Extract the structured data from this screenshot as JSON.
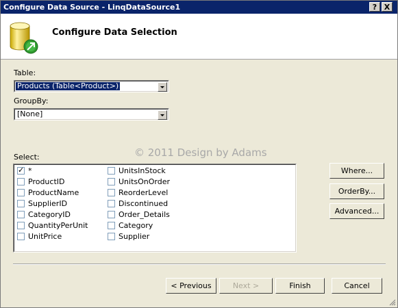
{
  "window": {
    "title": "Configure Data Source - LinqDataSource1",
    "help_btn": "?",
    "close_btn": "X"
  },
  "header": {
    "title": "Configure Data Selection",
    "icon": "database-icon"
  },
  "table": {
    "label": "Table:",
    "value": "Products (Table<Product>)"
  },
  "groupby": {
    "label": "GroupBy:",
    "value": "[None]"
  },
  "watermark": "© 2011 Design by Adams",
  "select": {
    "label": "Select:",
    "col1": [
      {
        "label": "*",
        "checked": true
      },
      {
        "label": "ProductID",
        "checked": false
      },
      {
        "label": "ProductName",
        "checked": false
      },
      {
        "label": "SupplierID",
        "checked": false
      },
      {
        "label": "CategoryID",
        "checked": false
      },
      {
        "label": "QuantityPerUnit",
        "checked": false
      },
      {
        "label": "UnitPrice",
        "checked": false
      }
    ],
    "col2": [
      {
        "label": "UnitsInStock",
        "checked": false
      },
      {
        "label": "UnitsOnOrder",
        "checked": false
      },
      {
        "label": "ReorderLevel",
        "checked": false
      },
      {
        "label": "Discontinued",
        "checked": false
      },
      {
        "label": "Order_Details",
        "checked": false
      },
      {
        "label": "Category",
        "checked": false
      },
      {
        "label": "Supplier",
        "checked": false
      }
    ]
  },
  "side_buttons": {
    "where": "Where...",
    "orderby": "OrderBy...",
    "advanced": "Advanced..."
  },
  "footer": {
    "previous": "< Previous",
    "next": "Next >",
    "finish": "Finish",
    "cancel": "Cancel"
  },
  "colors": {
    "title_bar": "#0a246a",
    "dialog_bg": "#ece9d8",
    "selection": "#0a246a"
  }
}
